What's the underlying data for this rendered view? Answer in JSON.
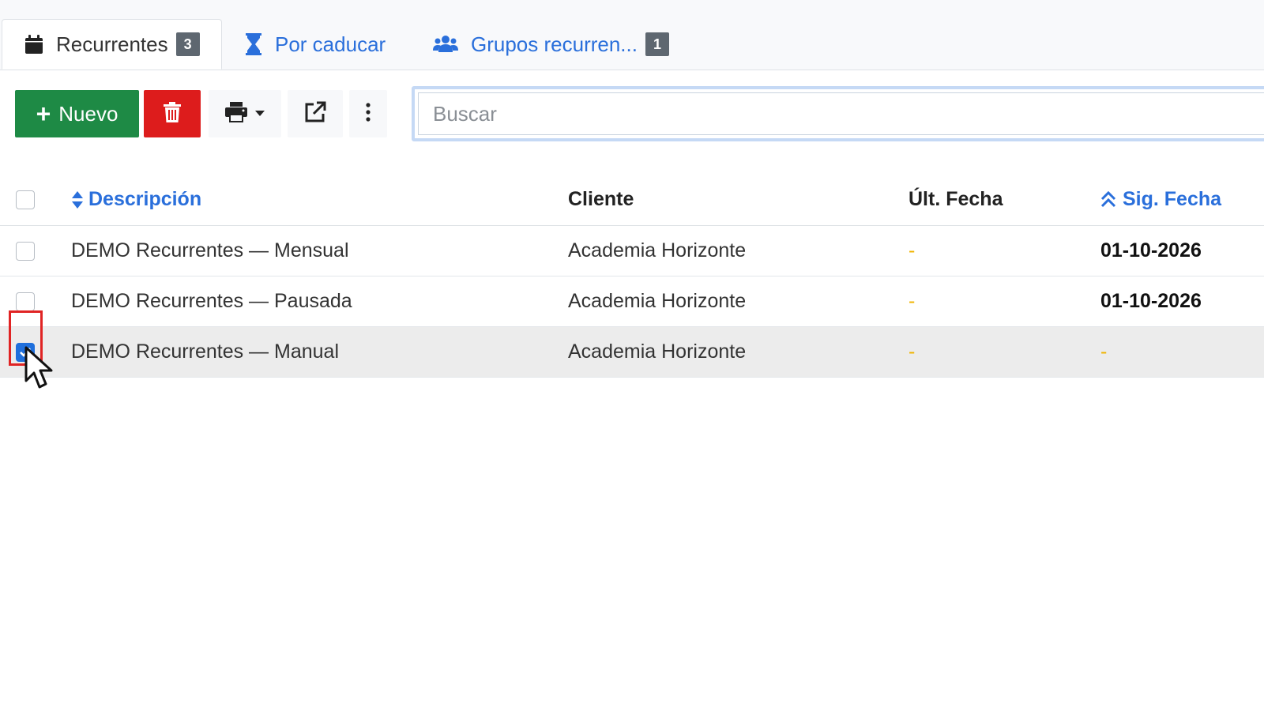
{
  "tabs": [
    {
      "label": "Recurrentes",
      "badge": "3",
      "icon": "calendar-icon",
      "active": true
    },
    {
      "label": "Por caducar",
      "icon": "hourglass-icon",
      "active": false
    },
    {
      "label": "Grupos recurren...",
      "badge": "1",
      "icon": "users-icon",
      "active": false
    }
  ],
  "toolbar": {
    "new_label": "Nuevo",
    "delete_icon": "trash-icon",
    "print_icon": "printer-icon",
    "export_icon": "external-link-icon",
    "more_icon": "vertical-dots-icon"
  },
  "search": {
    "placeholder": "Buscar",
    "value": ""
  },
  "table": {
    "columns": [
      "Descripción",
      "Cliente",
      "Últ. Fecha",
      "Sig. Fecha"
    ],
    "rows": [
      {
        "description": "DEMO Recurrentes — Mensual",
        "client": "Academia Horizonte",
        "last_date": "-",
        "next_date": "01-10-2026",
        "checked": false
      },
      {
        "description": "DEMO Recurrentes — Pausada",
        "client": "Academia Horizonte",
        "last_date": "-",
        "next_date": "01-10-2026",
        "checked": false
      },
      {
        "description": "DEMO Recurrentes — Manual",
        "client": "Academia Horizonte",
        "last_date": "-",
        "next_date": "-",
        "checked": true
      }
    ]
  },
  "colors": {
    "primary": "#2a6fdb",
    "success": "#1e8a45",
    "danger": "#dd1c1c",
    "warning": "#f0b400",
    "badge": "#5e6770"
  }
}
